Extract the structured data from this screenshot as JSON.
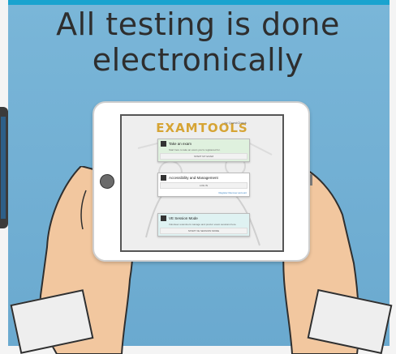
{
  "headline": {
    "line1": "All testing is done",
    "line2": "electronically"
  },
  "tablet": {
    "logo": "EXAMTOOLS",
    "logo_byline": "· by QuestCheck",
    "cards": [
      {
        "title": "Take an exam",
        "text": "Start here to take an exam you're registered for.",
        "button": "START MY EXAM"
      },
      {
        "title": "Accessibility and Management",
        "button": "LOG IN",
        "links": "Register  Recover account"
      },
      {
        "title": "VE Session Mode",
        "text": "Volunteer examiners manage and proctor exam sessions here.",
        "button": "START VE SESSION MODE"
      }
    ]
  },
  "colors": {
    "background": "#7fb8d9",
    "top_bar": "#1aa3cf",
    "headline": "#2e2e2e",
    "logo": "#d6a434"
  }
}
